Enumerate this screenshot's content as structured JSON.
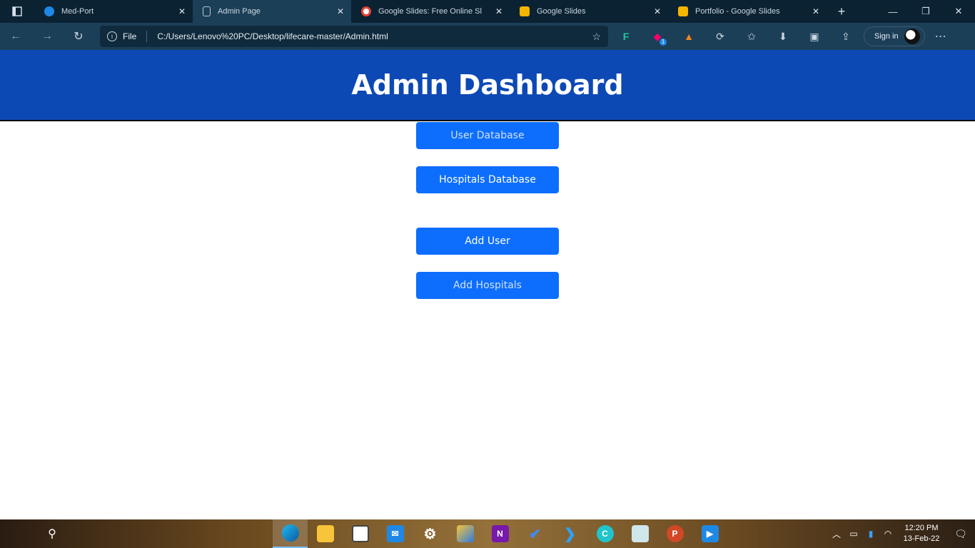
{
  "browser": {
    "tabs": [
      {
        "label": "Med-Port",
        "favicon_color": "#1e88e5",
        "active": false
      },
      {
        "label": "Admin Page",
        "favicon_color": "#b9c7d2",
        "active": true
      },
      {
        "label": "Google Slides: Free Online Sl",
        "favicon_color": "#ffffff",
        "active": false
      },
      {
        "label": "Google Slides",
        "favicon_color": "#f4b400",
        "active": false
      },
      {
        "label": "Portfolio - Google Slides",
        "favicon_color": "#f4b400",
        "active": false
      }
    ],
    "new_tab": "+",
    "address": {
      "scheme_label": "File",
      "url": "C:/Users/Lenovo%20PC/Desktop/lifecare-master/Admin.html"
    },
    "signin_label": "Sign in",
    "badge_count": "1"
  },
  "page": {
    "title": "Admin Dashboard",
    "buttons": {
      "user_database": "User Database",
      "hospitals_database": "Hospitals Database",
      "add_user": "Add User",
      "add_hospitals": "Add Hospitals"
    },
    "colors": {
      "header": "#0d49b5",
      "button": "#0d6efd"
    }
  },
  "taskbar": {
    "time": "12:20 PM",
    "date": "13-Feb-22"
  }
}
